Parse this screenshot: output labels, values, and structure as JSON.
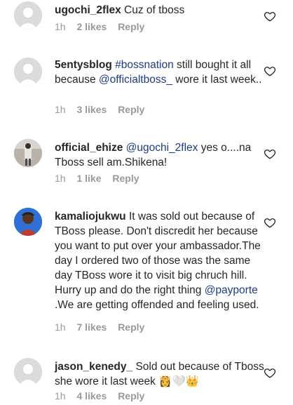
{
  "comments": [
    {
      "username": "ugochi_2flex",
      "parts": [
        " Cuz of tboss"
      ],
      "time": "1h",
      "likes": "2 likes",
      "reply": "Reply",
      "heart_icon": "heart-outline-icon"
    },
    {
      "username": "5entysblog",
      "parts": [
        " ",
        "#bossnation",
        " still bought it all because ",
        "@officialtboss_",
        " wore it last week.."
      ],
      "time": "1h",
      "likes": "3 likes",
      "reply": "Reply",
      "heart_icon": "heart-outline-icon"
    },
    {
      "username": "official_ehize",
      "parts": [
        " ",
        "@ugochi_2flex",
        " yes o....na Tboss sell am.Shikena!"
      ],
      "time": "1h",
      "likes": "1 like",
      "reply": "Reply",
      "heart_icon": "heart-outline-icon"
    },
    {
      "username": "kamaliojukwu",
      "parts": [
        " It was sold out because of TBoss please. Don't discredit her because you want to put over your ambassador.The day I ordered two of those was the same day TBoss wore it to visit big chruch hill. Hurry up and do the right thing ",
        "@payporte",
        " .We are getting offended and feeling used."
      ],
      "time": "1h",
      "likes": "7 likes",
      "reply": "Reply",
      "heart_icon": "heart-outline-icon"
    },
    {
      "username": "jason_kenedy_",
      "parts": [
        " Sold out because of Tboss she wore it last week ",
        "👸🤍👑"
      ],
      "time": "1h",
      "likes": "4 likes",
      "reply": "Reply",
      "heart_icon": "heart-outline-icon"
    }
  ],
  "colors": {
    "text": "#262626",
    "meta": "#999999",
    "mention": "#1e3a8a",
    "avatar_placeholder": "#dbdbdb"
  }
}
